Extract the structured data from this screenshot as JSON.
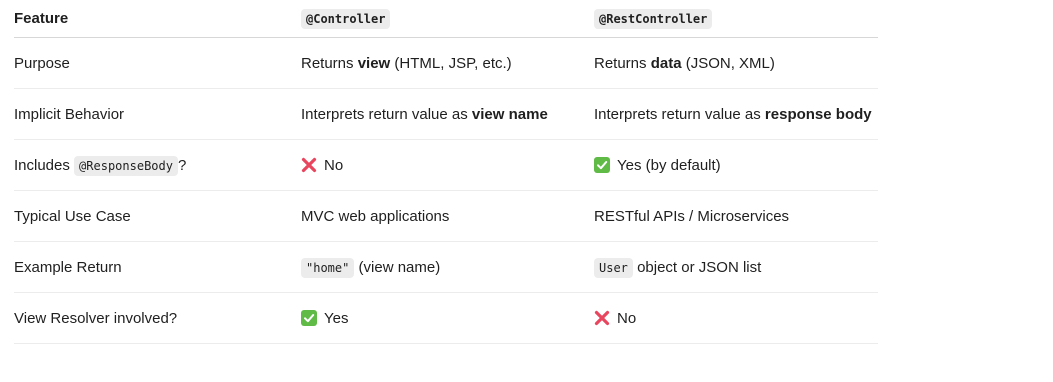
{
  "table": {
    "headers": {
      "feature": "Feature",
      "controller": "@Controller",
      "rest_controller": "@RestController"
    },
    "rows": [
      {
        "feature": "Purpose",
        "controller": {
          "pre": "Returns ",
          "bold": "view",
          "post": " (HTML, JSP, etc.)"
        },
        "rest": {
          "pre": "Returns ",
          "bold": "data",
          "post": " (JSON, XML)"
        }
      },
      {
        "feature": "Implicit Behavior",
        "controller": {
          "pre": "Interprets return value as ",
          "bold": "view name"
        },
        "rest": {
          "pre": "Interprets return value as ",
          "bold": "response body"
        }
      },
      {
        "feature": {
          "pre": "Includes ",
          "code": "@ResponseBody",
          "post": "?"
        },
        "controller": {
          "icon": "cross-mark-icon",
          "text": "No"
        },
        "rest": {
          "icon": "check-mark-icon",
          "text": "Yes (by default)"
        }
      },
      {
        "feature": "Typical Use Case",
        "controller": "MVC web applications",
        "rest": "RESTful APIs / Microservices"
      },
      {
        "feature": "Example Return",
        "controller": {
          "code": "\"home\"",
          "post": " (view name)"
        },
        "rest": {
          "code": "User",
          "post": " object or JSON list"
        }
      },
      {
        "feature": "View Resolver involved?",
        "controller": {
          "icon": "check-mark-icon",
          "text": "Yes"
        },
        "rest": {
          "icon": "cross-mark-icon",
          "text": "No"
        }
      }
    ]
  },
  "colors": {
    "check_green": "#5fba46",
    "cross_red": "#e8455f",
    "code_bg": "#ececec"
  }
}
